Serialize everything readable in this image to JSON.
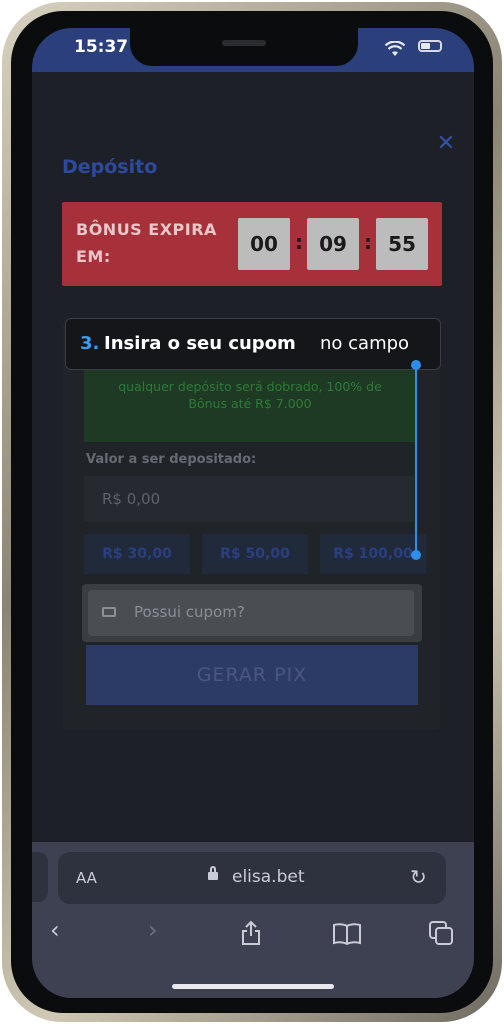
{
  "status_bar": {
    "time": "15:37"
  },
  "page": {
    "title": "Depósito",
    "close_symbol": "✕",
    "bonus": {
      "label": "BÔNUS EXPIRA EM:",
      "timer": [
        "00",
        "09",
        "55"
      ],
      "separator": ":"
    },
    "promo_lines": [
      "",
      "qualquer depósito será dobrado, 100% de",
      "Bônus até R$ 7.000"
    ],
    "amount_label": "Valor a ser depositado:",
    "amount_value": "R$ 0,00",
    "quick_amounts": [
      "R$ 30,00",
      "R$ 50,00",
      "R$ 100,00"
    ],
    "coupon_placeholder": "Possui cupom?",
    "generate_button": "GERAR PIX"
  },
  "tooltip": {
    "step": "3.",
    "bold_text": "Insira o seu cupom",
    "normal_text": "no campo"
  },
  "browser": {
    "text_size_label": "AA",
    "domain": "elisa.bet",
    "icons": [
      "back-icon",
      "forward-icon",
      "share-icon",
      "bookmarks-icon",
      "tabs-icon"
    ]
  },
  "colors": {
    "accent_blue": "#2f8fe8",
    "bonus_red": "#a6313a",
    "title_blue": "#2d4a9e"
  }
}
